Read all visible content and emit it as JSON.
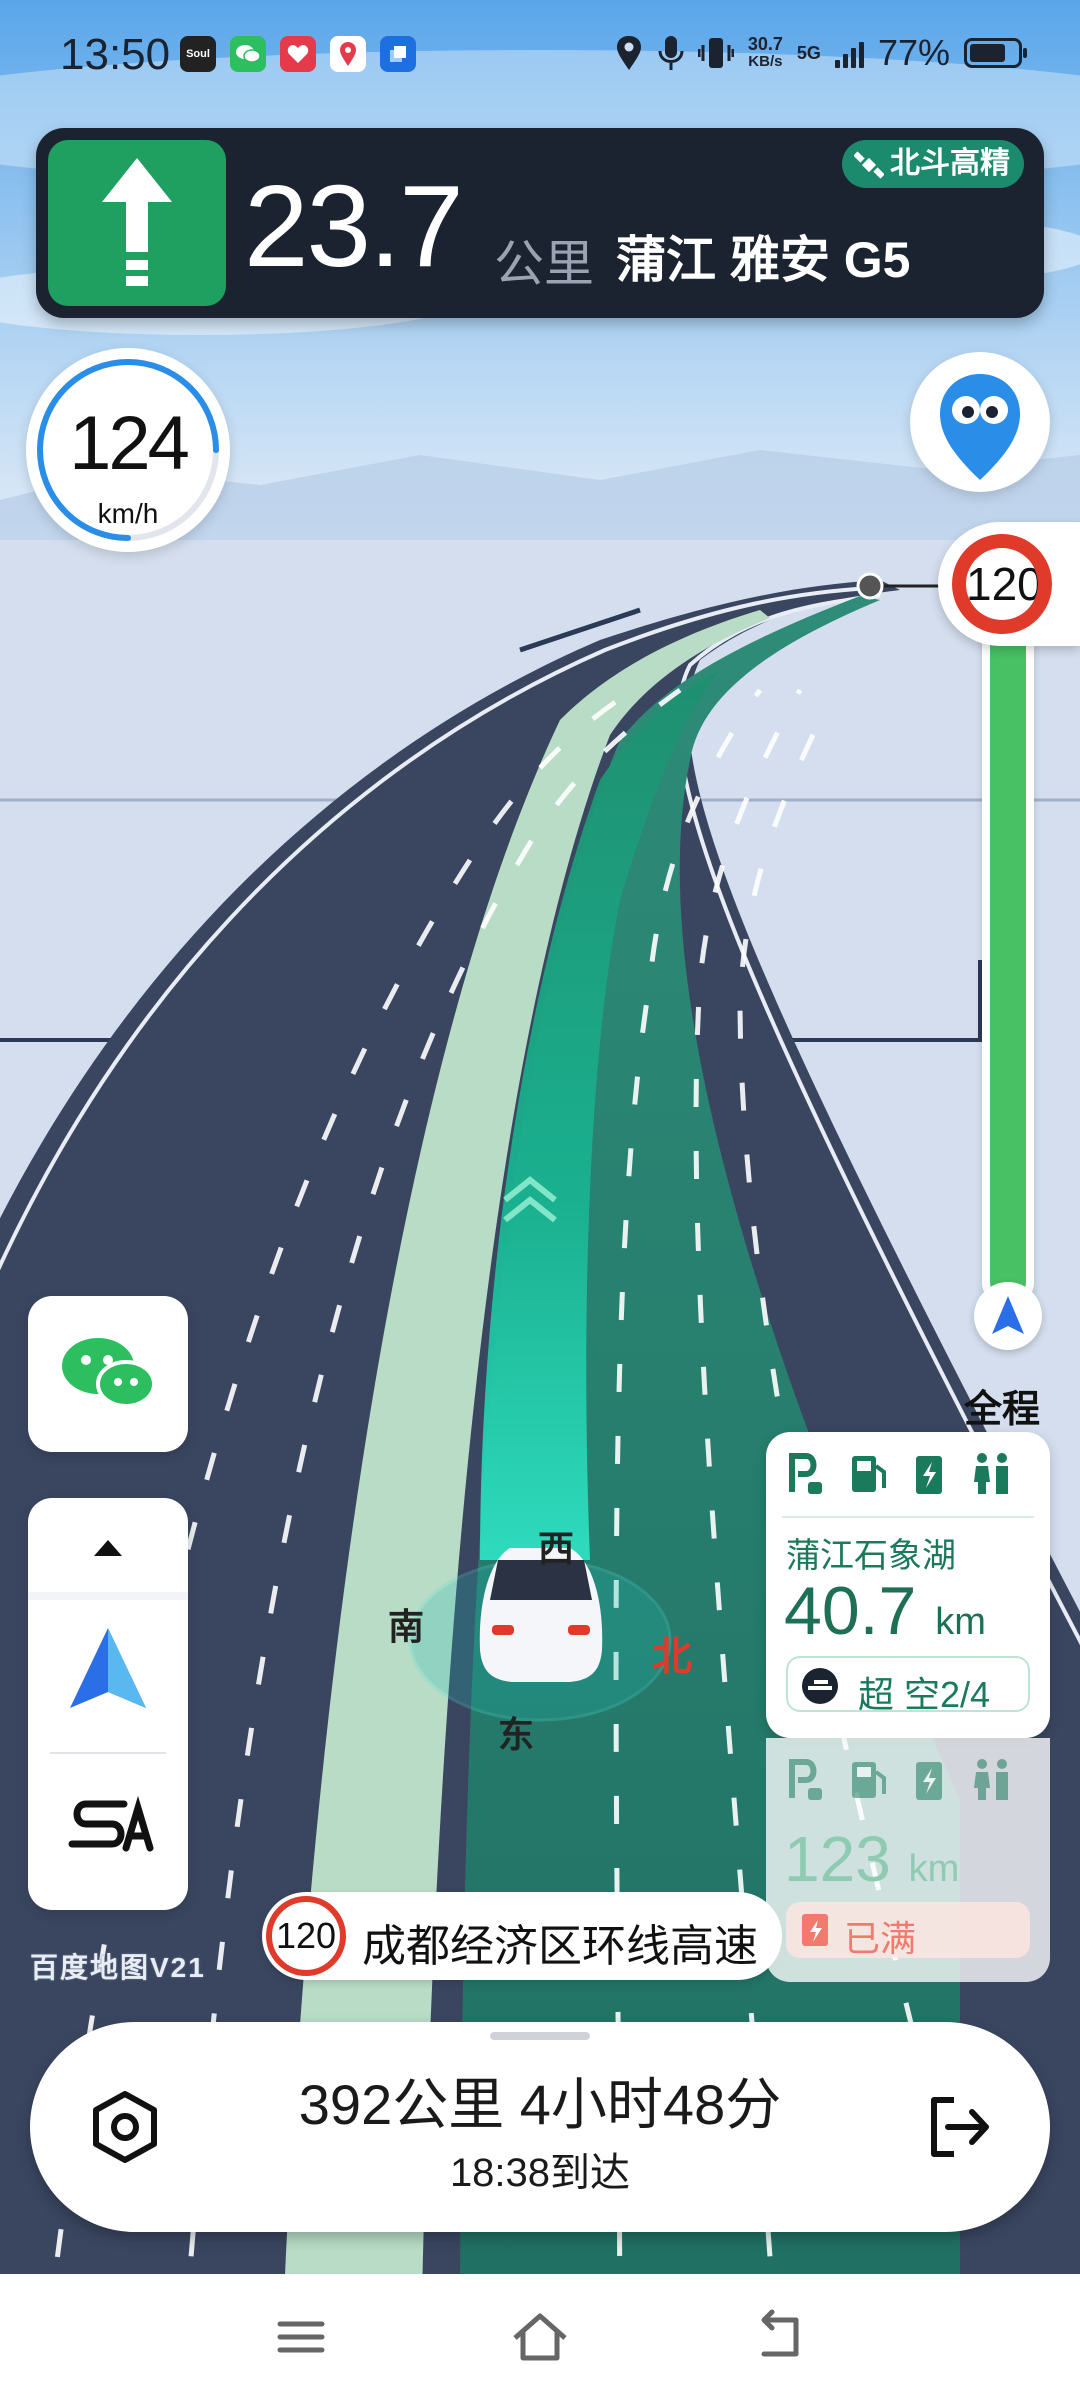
{
  "status_bar": {
    "time": "13:50",
    "apps": [
      {
        "icon": "soul-icon",
        "label": "Soul",
        "color": "#222222"
      },
      {
        "icon": "wechat-icon",
        "label": "",
        "color": "#2dbe60"
      },
      {
        "icon": "heart-app-icon",
        "label": "",
        "color": "#e43a4a"
      },
      {
        "icon": "map-pin-app-icon",
        "label": "",
        "color": "#ffffff"
      },
      {
        "icon": "square-app-icon",
        "label": "",
        "color": "#1e6fe0"
      }
    ],
    "net_speed_value": "30.7",
    "net_speed_unit": "KB/s",
    "network": "5G",
    "battery": "77%",
    "battery_level": 0.77
  },
  "banner": {
    "turn": "straight-arrow-icon",
    "distance": "23.7",
    "unit": "公里",
    "road": "蒲江 雅安 G5",
    "badge": "北斗高精"
  },
  "speed": {
    "value": "124",
    "unit": "km/h",
    "arc_fraction": 0.75
  },
  "speed_limit_top": "120",
  "progress": {
    "fraction": 0.98,
    "label": "全程"
  },
  "compass": {
    "west": "西",
    "south": "南",
    "north": "北",
    "east": "东"
  },
  "current_road": {
    "limit": "120",
    "name": "成都经济区环线高速"
  },
  "service_areas": [
    {
      "name": "蒲江石象湖",
      "distance": "40.7",
      "unit": "km",
      "charge_status": "超 空2/4",
      "facilities": [
        "parking-icon",
        "fuel-icon",
        "charging-icon",
        "restroom-icon"
      ]
    },
    {
      "name": "",
      "distance": "123",
      "unit": "km",
      "charge_status": "已满",
      "facilities": [
        "parking-icon",
        "fuel-icon",
        "charging-icon",
        "restroom-icon"
      ]
    }
  ],
  "logo": "百度地图V21",
  "trip": {
    "summary": "392公里 4小时48分",
    "eta": "18:38到达"
  },
  "colors": {
    "route_green": "#1fa061",
    "banner_bg": "#1b2331",
    "limit_red": "#e03a2b",
    "progress_green": "#48c064"
  }
}
